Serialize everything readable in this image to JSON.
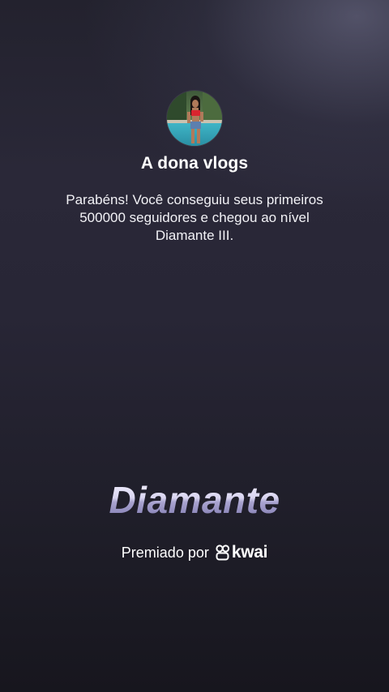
{
  "profile": {
    "username": "A dona vlogs",
    "avatar_icon": "profile-photo"
  },
  "message": {
    "text": "Parabéns! Você conseguiu seus primeiros 500000 seguidores e chegou ao nível Diamante III."
  },
  "level": {
    "title": "Diamante"
  },
  "award": {
    "label": "Premiado por",
    "brand": "kwai",
    "brand_icon": "kwai-logo-icon"
  },
  "colors": {
    "text": "#ffffff",
    "background_top": "#23222e",
    "background_bottom": "#17161e",
    "diamond_light": "#e6e2f6",
    "diamond_dark": "#7d78ad"
  }
}
